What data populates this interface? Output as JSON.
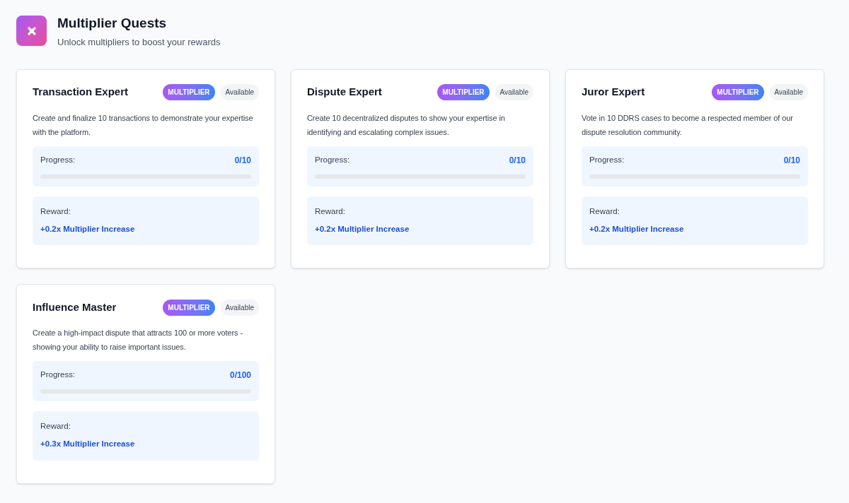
{
  "header": {
    "title": "Multiplier Quests",
    "subtitle": "Unlock multipliers to boost your rewards"
  },
  "quests": [
    {
      "title": "Transaction Expert",
      "badge": "MULTIPLIER",
      "status": "Available",
      "description": "Create and finalize 10 transactions to demonstrate your expertise with the platform.",
      "progress_label": "Progress:",
      "progress_value": "0/10",
      "level": 0,
      "reward_label": "Reward:",
      "reward": "+0.2x Multiplier Increase"
    },
    {
      "title": "Dispute Expert",
      "badge": "MULTIPLIER",
      "status": "Available",
      "description": "Create 10 decentralized disputes to show your expertise in identifying and escalating complex issues.",
      "progress_label": "Progress:",
      "progress_value": "0/10",
      "level": 0,
      "reward_label": "Reward:",
      "reward": "+0.2x Multiplier Increase"
    },
    {
      "title": "Juror Expert",
      "badge": "MULTIPLIER",
      "status": "Available",
      "description": "Vote in 10 DDRS cases to become a respected member of our dispute resolution community.",
      "progress_label": "Progress:",
      "progress_value": "0/10",
      "level": 0,
      "reward_label": "Reward:",
      "reward": "+0.2x Multiplier Increase"
    },
    {
      "title": "Influence Master",
      "badge": "MULTIPLIER",
      "status": "Available",
      "description": "Create a high-impact dispute that attracts 100 or more voters - showing your ability to raise important issues.",
      "progress_label": "Progress:",
      "progress_value": "0/100",
      "level": 0,
      "reward_label": "Reward:",
      "reward": "+0.3x Multiplier Increase"
    }
  ]
}
